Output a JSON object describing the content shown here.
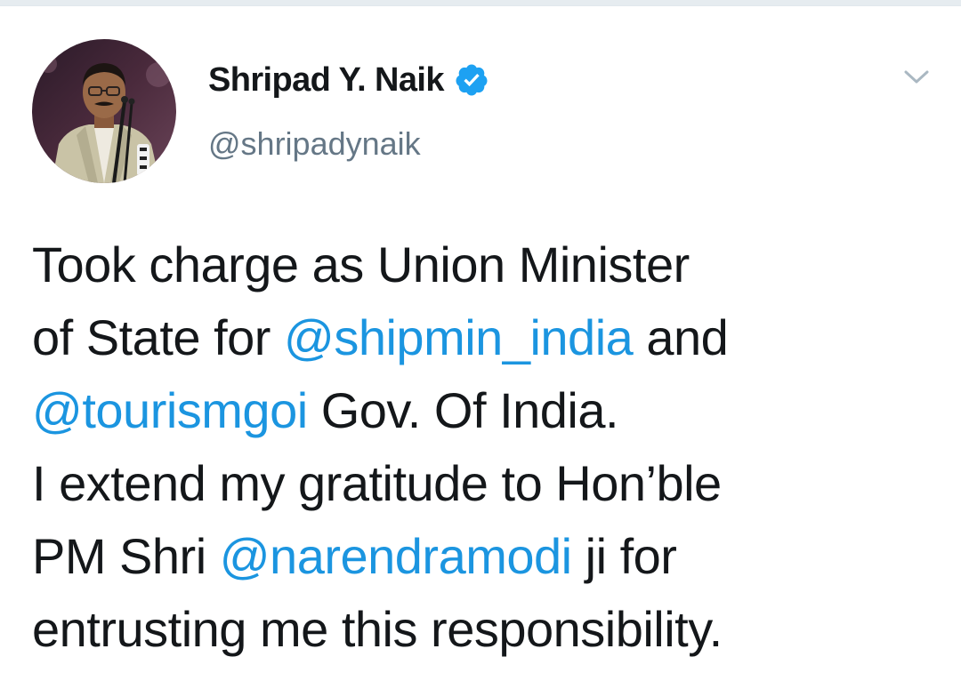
{
  "colors": {
    "text": "#14171a",
    "secondary_text": "#657786",
    "link": "#1b95e0",
    "verified_badge": "#1da1f2",
    "divider": "#e6ecf0"
  },
  "tweet": {
    "author": {
      "display_name": "Shripad Y. Naik",
      "handle": "@shripadynaik",
      "verified": true,
      "avatar_icon": "profile-photo"
    },
    "menu_icon": "chevron-down-icon",
    "text_lines": [
      {
        "parts": [
          {
            "text": "Took charge as Union Minister",
            "mention": false
          }
        ]
      },
      {
        "parts": [
          {
            "text": "of State for ",
            "mention": false
          },
          {
            "text": "@shipmin_india",
            "mention": true
          },
          {
            "text": " and",
            "mention": false
          }
        ]
      },
      {
        "parts": [
          {
            "text": "@tourismgoi",
            "mention": true
          },
          {
            "text": " Gov. Of India.",
            "mention": false
          }
        ]
      },
      {
        "parts": [
          {
            "text": "I extend my gratitude to Hon’ble",
            "mention": false
          }
        ]
      },
      {
        "parts": [
          {
            "text": "PM Shri ",
            "mention": false
          },
          {
            "text": "@narendramodi",
            "mention": true
          },
          {
            "text": " ji for",
            "mention": false
          }
        ]
      },
      {
        "parts": [
          {
            "text": "entrusting me this responsibility.",
            "mention": false
          }
        ]
      }
    ]
  }
}
